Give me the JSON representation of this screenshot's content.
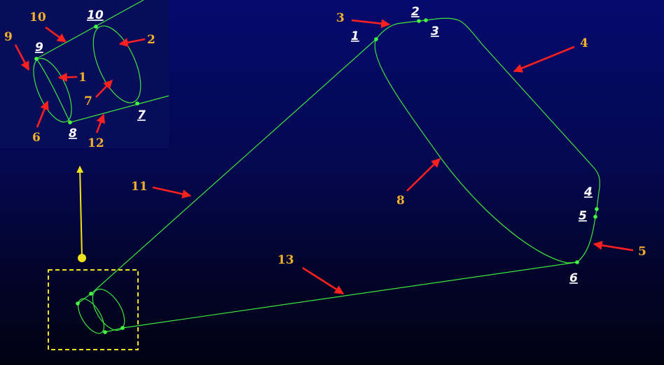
{
  "colors": {
    "curve": "#3ee63e",
    "point": "#44ff44",
    "arrow": "#ff2020",
    "label_number": "#f2b12a",
    "label_point": "#ffffff",
    "pointer": "#f2e21a",
    "highlight_box": "#f2e21a"
  },
  "main_labels": {
    "p1": "1",
    "p2": "2",
    "p3": "3",
    "p4": "4",
    "p5": "5",
    "p6": "6",
    "n3": "3",
    "n4": "4",
    "n5": "5",
    "n8": "8",
    "n11": "11",
    "n13": "13"
  },
  "inset_labels": {
    "p7": "7",
    "p8": "8",
    "p9": "9",
    "p10": "10",
    "n1": "1",
    "n2": "2",
    "n6": "6",
    "n7": "7",
    "n9": "9",
    "n10": "10",
    "n12": "12"
  }
}
